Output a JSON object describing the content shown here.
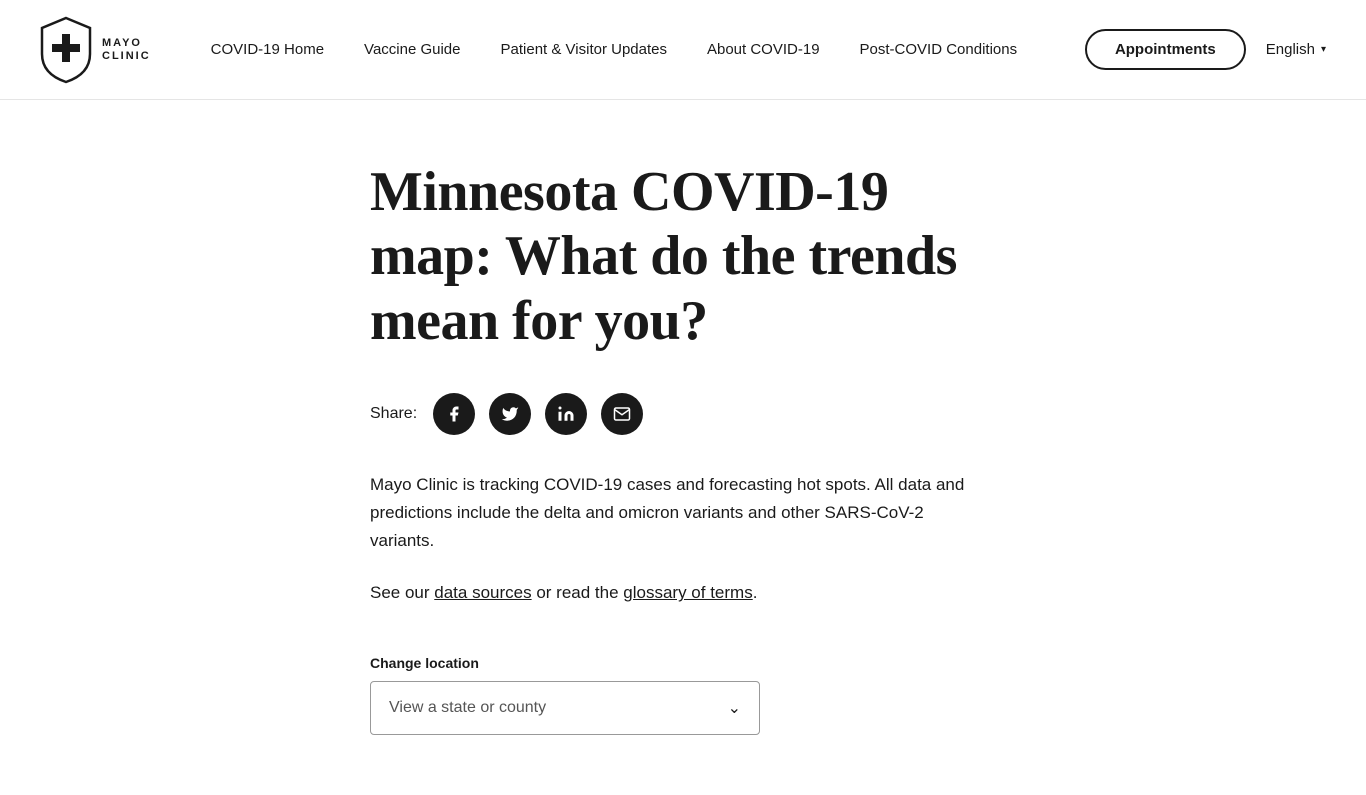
{
  "header": {
    "logo": {
      "line1": "MAYO",
      "line2": "CLINIC"
    },
    "nav": {
      "items": [
        {
          "id": "covid-home",
          "label": "COVID-19 Home"
        },
        {
          "id": "vaccine-guide",
          "label": "Vaccine Guide"
        },
        {
          "id": "patient-visitor",
          "label": "Patient & Visitor Updates"
        },
        {
          "id": "about-covid",
          "label": "About COVID-19"
        },
        {
          "id": "post-covid",
          "label": "Post-COVID Conditions"
        }
      ]
    },
    "appointments_button": "Appointments",
    "language": {
      "label": "English",
      "chevron": "▾"
    }
  },
  "main": {
    "title": "Minnesota COVID-19 map: What do the trends mean for you?",
    "share": {
      "label": "Share:",
      "icons": [
        {
          "id": "facebook",
          "symbol": "f"
        },
        {
          "id": "twitter",
          "symbol": "𝕏"
        },
        {
          "id": "linkedin",
          "symbol": "in"
        },
        {
          "id": "email",
          "symbol": "✉"
        }
      ]
    },
    "body_text": "Mayo Clinic is tracking COVID-19 cases and forecasting hot spots. All data and predictions include the delta and omicron variants and other SARS-CoV-2 variants.",
    "see_our": {
      "prefix": "See our ",
      "data_sources_link": "data sources",
      "middle": " or read the ",
      "glossary_link": "glossary of terms",
      "suffix": "."
    },
    "location": {
      "label": "Change location",
      "placeholder": "View a state or county",
      "chevron": "⌄"
    }
  }
}
